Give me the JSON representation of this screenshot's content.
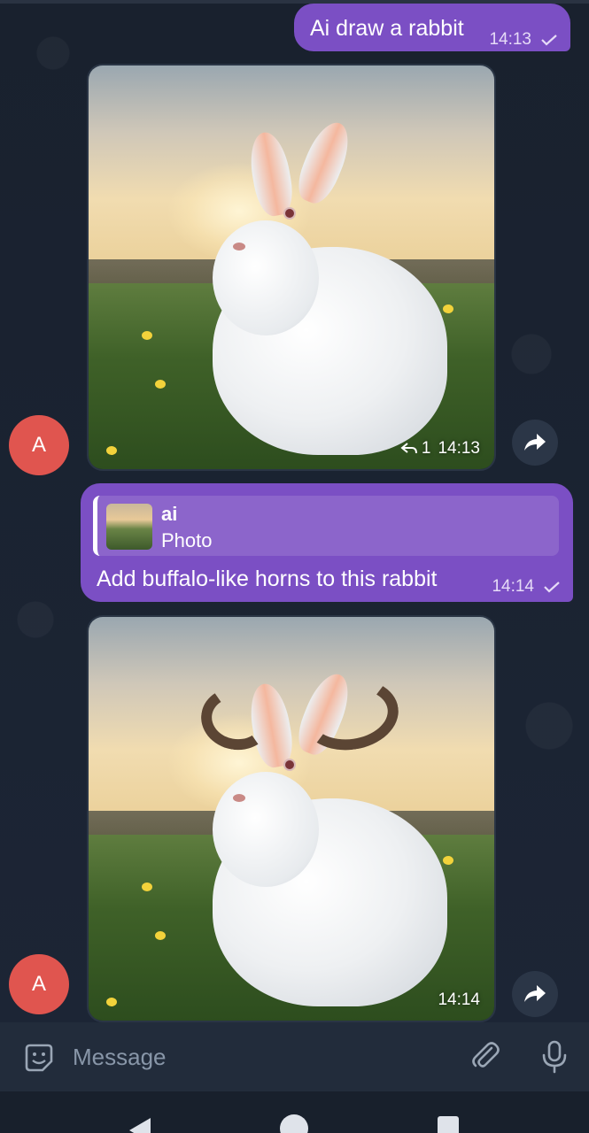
{
  "messages": {
    "m1": {
      "text": "Ai draw a rabbit",
      "time": "14:13"
    },
    "img1": {
      "reply_count": "1",
      "time": "14:13"
    },
    "m2": {
      "reply_to_name": "ai",
      "reply_to_text": "Photo",
      "text": "Add buffalo-like horns to this rabbit",
      "time": "14:14"
    },
    "img2": {
      "time": "14:14"
    }
  },
  "avatar": {
    "initial": "A"
  },
  "composer": {
    "placeholder": "Message"
  },
  "colors": {
    "outgoing_bubble": "#7b4fc4",
    "avatar": "#e0554f",
    "background": "#1b2433"
  },
  "icons": [
    "check-icon",
    "reply-icon",
    "share-icon",
    "sticker-icon",
    "attach-icon",
    "mic-icon",
    "nav-back-icon",
    "nav-home-icon",
    "nav-recent-icon"
  ]
}
